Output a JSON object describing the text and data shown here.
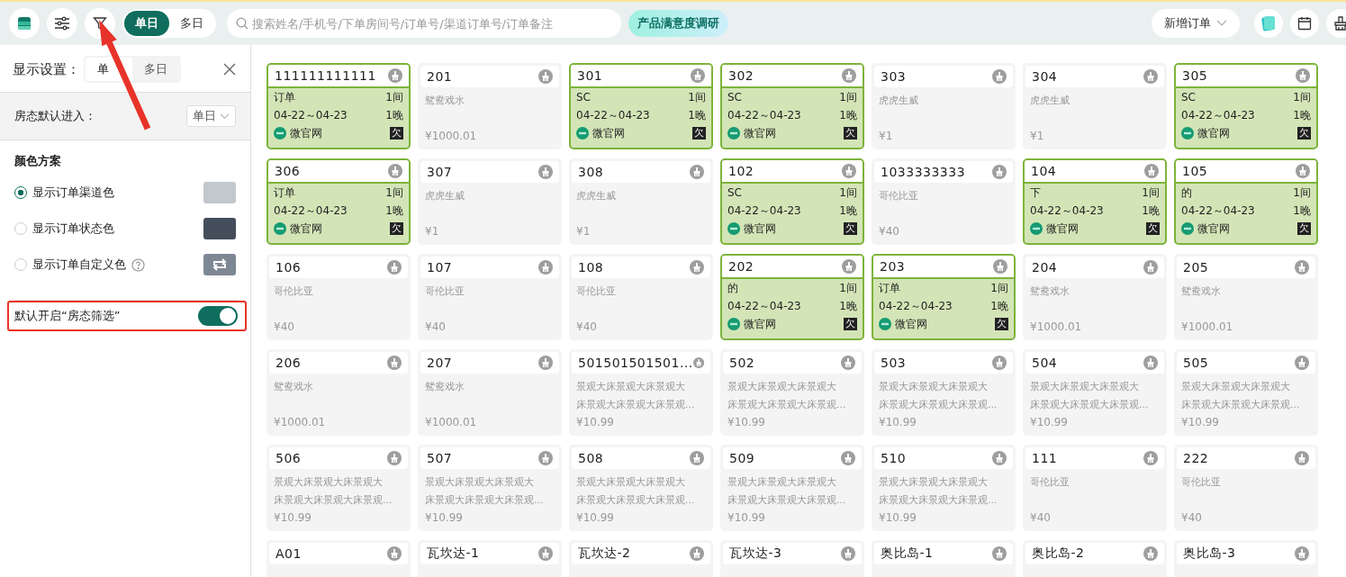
{
  "toolbar": {
    "views": [
      {
        "label": "单日",
        "selected": true
      },
      {
        "label": "多日",
        "selected": false
      }
    ],
    "search": {
      "placeholder": "搜索姓名/手机号/下单房间号/订单号/渠道订单号/订单备注"
    },
    "survey": "产品满意度调研",
    "new_order": "新增订单"
  },
  "panel": {
    "title": "显示设置：",
    "tabs": [
      {
        "label": "单",
        "selected": true
      },
      {
        "label": "多日",
        "selected": false
      }
    ],
    "default_entry": {
      "label": "房态默认进入：",
      "value": "单日"
    },
    "color_scheme": {
      "title": "颜色方案",
      "options": [
        {
          "label": "显示订单渠道色",
          "selected": true,
          "kind": "swatch",
          "color": "#c3c7ce"
        },
        {
          "label": "显示订单状态色",
          "selected": false,
          "kind": "swatch",
          "color": "#444d5a"
        },
        {
          "label": "显示订单自定义色",
          "selected": false,
          "kind": "custom",
          "color": "#7e8794"
        }
      ]
    },
    "filter_toggle": {
      "label": "默认开启“房态筛选”",
      "on": true
    }
  },
  "rooms": [
    {
      "name": "111111111111",
      "kind": "occupied",
      "guest": "订单",
      "rooms": "1间",
      "dates": "04-22～04-23",
      "nights": "1晚",
      "channel": "微官网",
      "badge": "欠"
    },
    {
      "name": "201",
      "kind": "vacant",
      "type": "鸳鸯戏水",
      "price": "¥1000.01"
    },
    {
      "name": "301",
      "kind": "occupied",
      "guest": "SC",
      "rooms": "1间",
      "dates": "04-22～04-23",
      "nights": "1晚",
      "channel": "微官网",
      "badge": "欠"
    },
    {
      "name": "302",
      "kind": "occupied",
      "guest": "SC",
      "rooms": "1间",
      "dates": "04-22～04-23",
      "nights": "1晚",
      "channel": "微官网",
      "badge": "欠"
    },
    {
      "name": "303",
      "kind": "vacant",
      "type": "虎虎生威",
      "price": "¥1"
    },
    {
      "name": "304",
      "kind": "vacant",
      "type": "虎虎生威",
      "price": "¥1"
    },
    {
      "name": "305",
      "kind": "occupied",
      "guest": "SC",
      "rooms": "1间",
      "dates": "04-22～04-23",
      "nights": "1晚",
      "channel": "微官网",
      "badge": "欠"
    },
    {
      "name": "306",
      "kind": "occupied",
      "guest": "订单",
      "rooms": "1间",
      "dates": "04-22～04-23",
      "nights": "1晚",
      "channel": "微官网",
      "badge": "欠"
    },
    {
      "name": "307",
      "kind": "vacant",
      "type": "虎虎生威",
      "price": "¥1"
    },
    {
      "name": "308",
      "kind": "vacant",
      "type": "虎虎生威",
      "price": "¥1"
    },
    {
      "name": "102",
      "kind": "occupied",
      "guest": "SC",
      "rooms": "1间",
      "dates": "04-22～04-23",
      "nights": "1晚",
      "channel": "微官网",
      "badge": "欠"
    },
    {
      "name": "1033333333",
      "kind": "vacant",
      "type": "哥伦比亚",
      "price": "¥40"
    },
    {
      "name": "104",
      "kind": "occupied",
      "guest": "下",
      "rooms": "1间",
      "dates": "04-22～04-23",
      "nights": "1晚",
      "channel": "微官网",
      "badge": "欠"
    },
    {
      "name": "105",
      "kind": "occupied",
      "guest": "的",
      "rooms": "1间",
      "dates": "04-22～04-23",
      "nights": "1晚",
      "channel": "微官网",
      "badge": "欠"
    },
    {
      "name": "106",
      "kind": "vacant",
      "type": "哥伦比亚",
      "price": "¥40"
    },
    {
      "name": "107",
      "kind": "vacant",
      "type": "哥伦比亚",
      "price": "¥40"
    },
    {
      "name": "108",
      "kind": "vacant",
      "type": "哥伦比亚",
      "price": "¥40"
    },
    {
      "name": "202",
      "kind": "occupied",
      "guest": "的",
      "rooms": "1间",
      "dates": "04-22～04-23",
      "nights": "1晚",
      "channel": "微官网",
      "badge": "欠"
    },
    {
      "name": "203",
      "kind": "occupied",
      "guest": "订单",
      "rooms": "1间",
      "dates": "04-22～04-23",
      "nights": "1晚",
      "channel": "微官网",
      "badge": "欠"
    },
    {
      "name": "204",
      "kind": "vacant",
      "type": "鸳鸯戏水",
      "price": "¥1000.01"
    },
    {
      "name": "205",
      "kind": "vacant",
      "type": "鸳鸯戏水",
      "price": "¥1000.01"
    },
    {
      "name": "206",
      "kind": "vacant",
      "type": "鸳鸯戏水",
      "price": "¥1000.01"
    },
    {
      "name": "207",
      "kind": "vacant",
      "type": "鸳鸯戏水",
      "price": "¥1000.01"
    },
    {
      "name": "501501501501...",
      "kind": "vacant",
      "type": "景观大床景观大床景观大床景观大床景观大床景观...",
      "price": "¥10.99"
    },
    {
      "name": "502",
      "kind": "vacant",
      "type": "景观大床景观大床景观大床景观大床景观大床景观...",
      "price": "¥10.99"
    },
    {
      "name": "503",
      "kind": "vacant",
      "type": "景观大床景观大床景观大床景观大床景观大床景观...",
      "price": "¥10.99"
    },
    {
      "name": "504",
      "kind": "vacant",
      "type": "景观大床景观大床景观大床景观大床景观大床景观...",
      "price": "¥10.99"
    },
    {
      "name": "505",
      "kind": "vacant",
      "type": "景观大床景观大床景观大床景观大床景观大床景观...",
      "price": "¥10.99"
    },
    {
      "name": "506",
      "kind": "vacant",
      "type": "景观大床景观大床景观大床景观大床景观大床景观...",
      "price": "¥10.99"
    },
    {
      "name": "507",
      "kind": "vacant",
      "type": "景观大床景观大床景观大床景观大床景观大床景观...",
      "price": "¥10.99"
    },
    {
      "name": "508",
      "kind": "vacant",
      "type": "景观大床景观大床景观大床景观大床景观大床景观...",
      "price": "¥10.99"
    },
    {
      "name": "509",
      "kind": "vacant",
      "type": "景观大床景观大床景观大床景观大床景观大床景观...",
      "price": "¥10.99"
    },
    {
      "name": "510",
      "kind": "vacant",
      "type": "景观大床景观大床景观大床景观大床景观大床景观...",
      "price": "¥10.99"
    },
    {
      "name": "111",
      "kind": "vacant",
      "type": "哥伦比亚",
      "price": "¥40"
    },
    {
      "name": "222",
      "kind": "vacant",
      "type": "哥伦比亚",
      "price": "¥40"
    },
    {
      "name": "A01",
      "kind": "cut"
    },
    {
      "name": "瓦坎达-1",
      "kind": "cut"
    },
    {
      "name": "瓦坎达-2",
      "kind": "cut"
    },
    {
      "name": "瓦坎达-3",
      "kind": "cut"
    },
    {
      "name": "奥比岛-1",
      "kind": "cut"
    },
    {
      "name": "奥比岛-2",
      "kind": "cut"
    },
    {
      "name": "奥比岛-3",
      "kind": "cut"
    }
  ]
}
